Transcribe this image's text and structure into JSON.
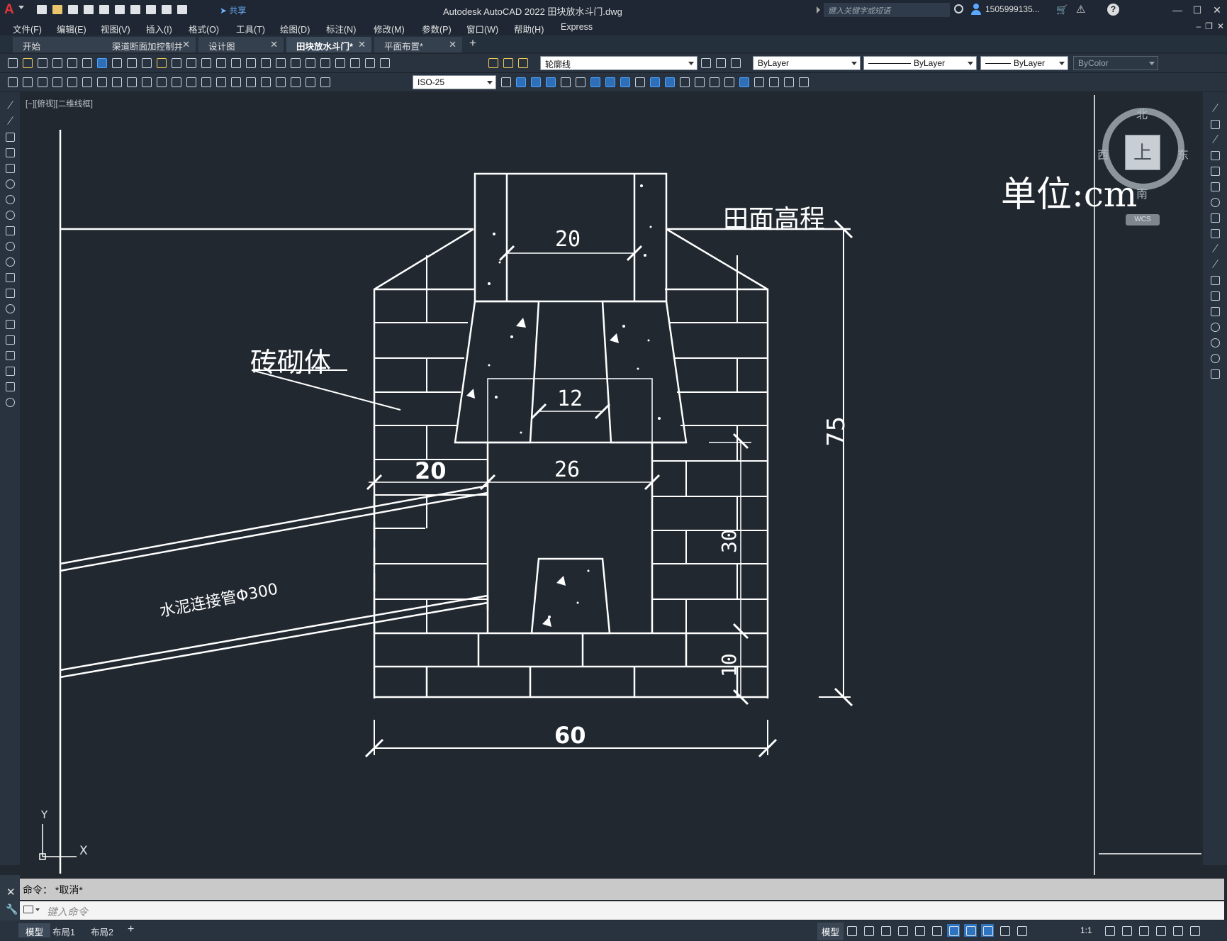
{
  "app": {
    "logo": "A",
    "share_label": "共享",
    "title": "Autodesk AutoCAD 2022    田块放水斗门.dwg",
    "search_placeholder": "键入关键字或短语",
    "user_name": "1505999135...",
    "cart": "🛒",
    "help": "?",
    "win_min": "—",
    "win_max": "☐",
    "win_close": "✕"
  },
  "menu": [
    "文件(F)",
    "编辑(E)",
    "视图(V)",
    "插入(I)",
    "格式(O)",
    "工具(T)",
    "绘图(D)",
    "标注(N)",
    "修改(M)",
    "参数(P)",
    "窗口(W)",
    "帮助(H)",
    "Express"
  ],
  "file_tabs": [
    {
      "label": "开始",
      "active": false
    },
    {
      "label": "渠道断面加控制井",
      "active": false
    },
    {
      "label": "设计图",
      "active": false
    },
    {
      "label": "田块放水斗门*",
      "active": true
    },
    {
      "label": "平面布置*",
      "active": false
    }
  ],
  "toolbar": {
    "layer": "轮廓线",
    "color": "ByLayer",
    "linetype": "ByLayer",
    "lineweight": "ByLayer",
    "plotstyle": "ByColor",
    "dimstyle": "ISO-25"
  },
  "viewport_label": "[−][俯视][二维线框]",
  "viewcube": {
    "north": "北",
    "south": "南",
    "west": "西",
    "east": "东",
    "face": "上",
    "wcs": "WCS"
  },
  "drawing": {
    "unit_note": "单位:cm",
    "field_elevation": "田面高程",
    "masonry": "砖砌体",
    "pipe": "水泥连接管Φ300",
    "dims": {
      "top_width": "20",
      "inner_width": "12",
      "wall": "20",
      "outlet": "26",
      "height_total": "75",
      "height_30": "30",
      "height_10": "10",
      "base_width": "60"
    }
  },
  "ucs": {
    "y": "Y",
    "x": "X"
  },
  "command": {
    "history": "命令： *取消*",
    "prompt": "键入命令"
  },
  "status": {
    "layouts": [
      {
        "label": "模型",
        "active": true
      },
      {
        "label": "布局1",
        "active": false
      },
      {
        "label": "布局2",
        "active": false
      }
    ],
    "model_button": "模型",
    "scale": "1:1"
  }
}
